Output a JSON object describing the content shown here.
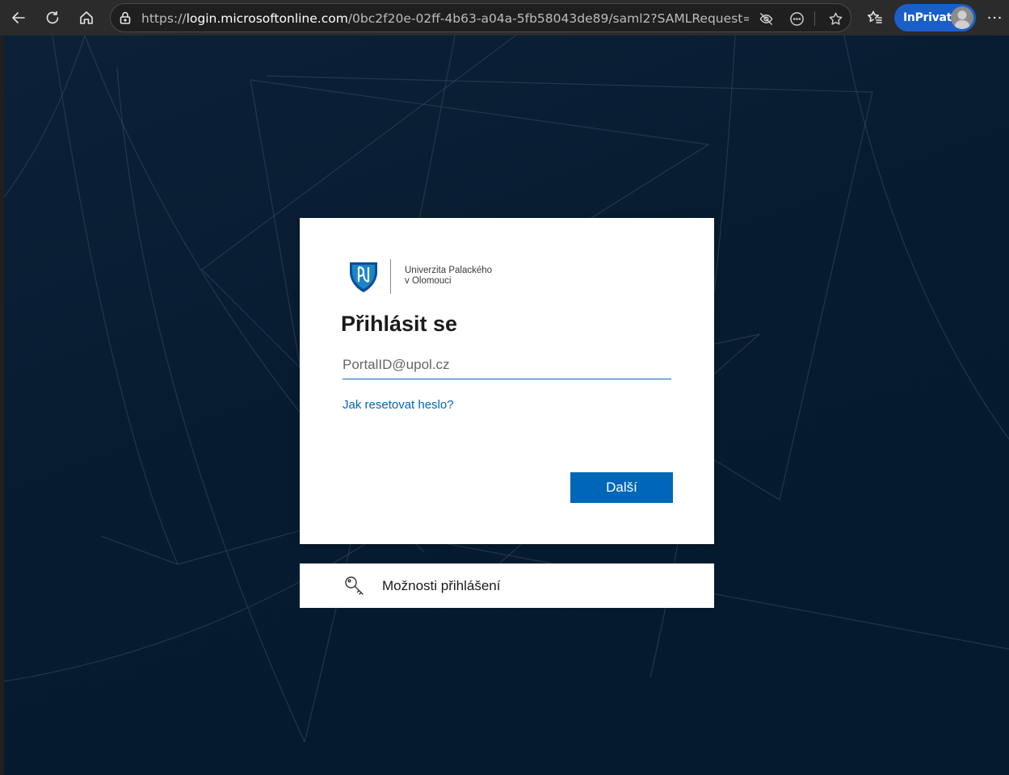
{
  "browser": {
    "url_host_prefix": "https://",
    "url_host": "login.microsoftonline.com",
    "url_rest": "/0bc2f20e-02ff-4b63-a04a-5fb58043de89/saml2?SAMLRequest=fVLL...",
    "inprivate_label": "InPrivate",
    "icons": {
      "back": "back-arrow-icon",
      "refresh": "refresh-icon",
      "home": "home-icon",
      "site_info": "lock-icon",
      "tracking": "eye-off-icon",
      "more_site": "ellipsis-circle-icon",
      "favorite": "star-icon",
      "favorites": "favorites-list-icon",
      "menu": "more-icon"
    },
    "accent_color": "#1a5fc8"
  },
  "login": {
    "org_name_line1": "Univerzita Palackého",
    "org_name_line2": "v Olomouci",
    "title": "Přihlásit se",
    "email_placeholder": "PortalID@upol.cz",
    "email_value": "",
    "reset_link": "Jak resetovat heslo?",
    "next_button": "Další",
    "options_label": "Možnosti přihlášení",
    "options_icon": "key-icon",
    "accent_color": "#0067b8"
  }
}
